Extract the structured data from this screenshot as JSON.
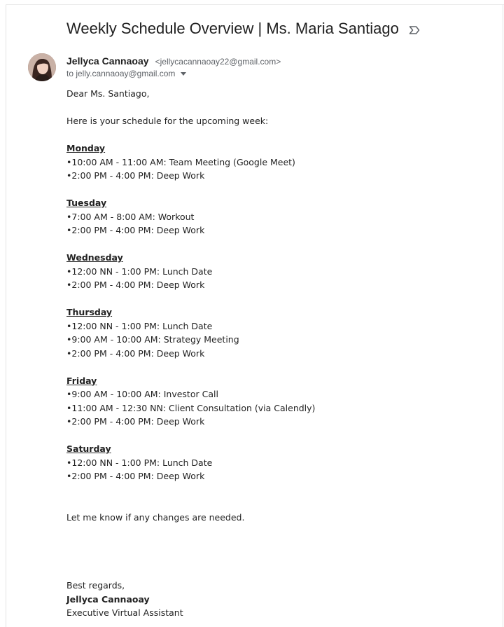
{
  "email": {
    "subject": "Weekly Schedule Overview | Ms. Maria Santiago",
    "label_icon": "label-important-icon",
    "sender": {
      "name": "Jellyca Cannaoay",
      "email": "<jellycacannaoay22@gmail.com>",
      "avatar": "avatar"
    },
    "to_line": "to jelly.cannaoay@gmail.com",
    "body": {
      "greeting": "Dear Ms. Santiago,",
      "intro": "Here is your schedule for the upcoming week:",
      "days": [
        {
          "name": "Monday",
          "items": [
            "•10:00 AM - 11:00 AM: Team Meeting (Google Meet)",
            "•2:00 PM - 4:00 PM: Deep Work"
          ]
        },
        {
          "name": "Tuesday",
          "items": [
            "•7:00 AM - 8:00 AM: Workout",
            "•2:00 PM - 4:00 PM: Deep Work"
          ]
        },
        {
          "name": "Wednesday",
          "items": [
            "•12:00 NN - 1:00 PM: Lunch Date",
            "•2:00 PM - 4:00 PM: Deep Work"
          ]
        },
        {
          "name": "Thursday",
          "items": [
            "•12:00 NN - 1:00 PM: Lunch Date",
            "•9:00 AM - 10:00 AM: Strategy Meeting",
            "•2:00 PM - 4:00 PM: Deep Work"
          ]
        },
        {
          "name": "Friday",
          "items": [
            "•9:00 AM - 10:00 AM: Investor Call",
            "•11:00 AM - 12:30 NN: Client Consultation (via Calendly)",
            "•2:00 PM - 4:00 PM: Deep Work"
          ]
        },
        {
          "name": "Saturday",
          "items": [
            "•12:00 NN - 1:00 PM: Lunch Date",
            "•2:00 PM - 4:00 PM: Deep Work"
          ]
        }
      ],
      "closing_note": "Let me know if any changes are needed.",
      "signoff": "Best regards,",
      "signature_name": "Jellyca Cannaoay",
      "signature_title": "Executive Virtual Assistant"
    }
  }
}
